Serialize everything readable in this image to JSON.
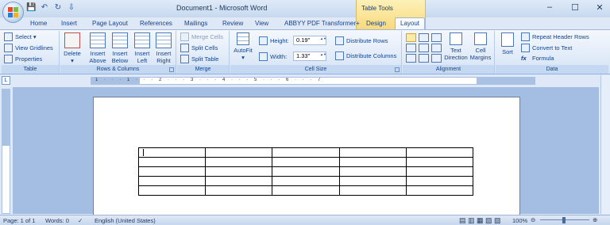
{
  "window": {
    "title": "Document1 - Microsoft Word",
    "context_tab_group": "Table Tools",
    "minimize": "–",
    "maximize": "☐",
    "close": "✕"
  },
  "qat": {
    "save": "💾",
    "undo": "↶",
    "redo": "↻",
    "customize": "⇩"
  },
  "tabs": [
    "Home",
    "Insert",
    "Page Layout",
    "References",
    "Mailings",
    "Review",
    "View",
    "ABBYY PDF Transformer+",
    "Design",
    "Layout"
  ],
  "active_tab": "Layout",
  "ribbon": {
    "table": {
      "select": "Select ▾",
      "view_gridlines": "View Gridlines",
      "properties": "Properties",
      "label": "Table"
    },
    "rows_columns": {
      "delete": "Delete",
      "delete_arrow": "▾",
      "insert_above": "Insert Above",
      "insert_below": "Insert Below",
      "insert_left": "Insert Left",
      "insert_right": "Insert Right",
      "label": "Rows & Columns"
    },
    "merge": {
      "merge_cells": "Merge Cells",
      "split_cells": "Split Cells",
      "split_table": "Split Table",
      "label": "Merge"
    },
    "cell_size": {
      "autofit": "AutoFit",
      "autofit_arrow": "▾",
      "height_label": "Height:",
      "height_value": "0.19\"",
      "width_label": "Width:",
      "width_value": "1.33\"",
      "distribute_rows": "Distribute Rows",
      "distribute_columns": "Distribute Columns",
      "label": "Cell Size"
    },
    "alignment": {
      "text_direction": "Text Direction",
      "cell_margins": "Cell Margins",
      "label": "Alignment"
    },
    "data": {
      "sort": "Sort",
      "repeat_header_rows": "Repeat Header Rows",
      "convert_to_text": "Convert to Text",
      "formula": "Formula",
      "label": "Data"
    }
  },
  "ruler": {
    "tab_selector": "L",
    "numbers": "1 · · · 1 · · · 2 · · · 3 · · · 4 · · · 5 · · · 6 · · · 7"
  },
  "table": {
    "rows": 5,
    "cols": 5
  },
  "statusbar": {
    "page": "Page: 1 of 1",
    "words": "Words: 0",
    "language": "English (United States)",
    "zoom": "100%",
    "zoom_out": "⊖",
    "zoom_in": "⊕"
  }
}
